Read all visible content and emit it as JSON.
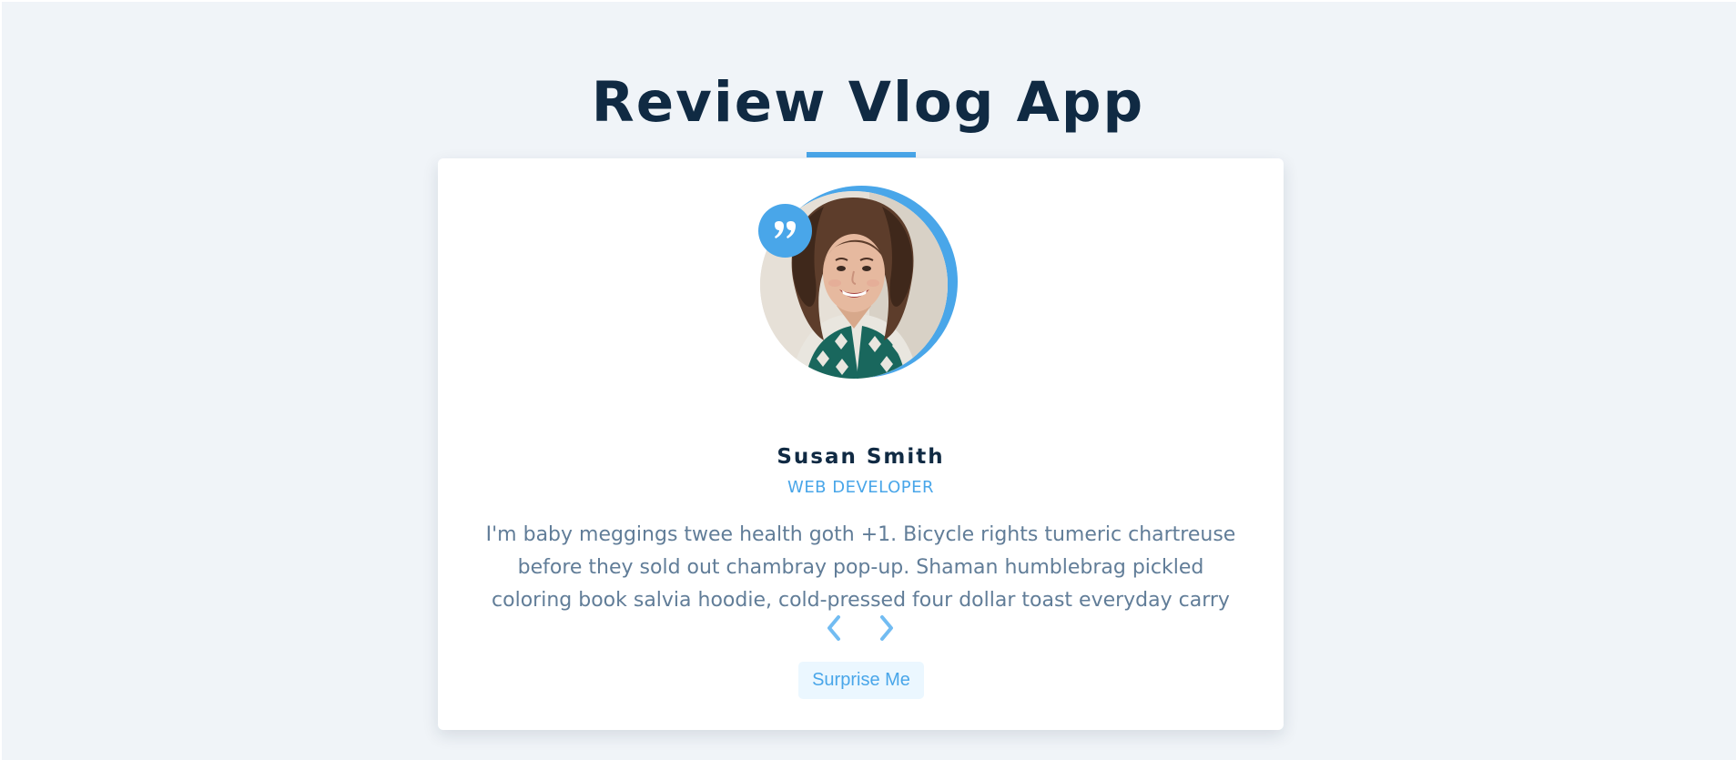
{
  "page": {
    "title": "Review Vlog App"
  },
  "review": {
    "name": "Susan Smith",
    "job": "WEB DEVELOPER",
    "text": "I'm baby meggings twee health goth +1. Bicycle rights tumeric chartreuse before they sold out chambray pop-up. Shaman humblebrag pickled coloring book salvia hoodie, cold-pressed four dollar toast everyday carry",
    "avatar_icon": "person-photo",
    "quote_icon": "quote-icon"
  },
  "controls": {
    "prev_icon": "chevron-left-icon",
    "next_icon": "chevron-right-icon",
    "surprise_label": "Surprise Me"
  },
  "colors": {
    "background": "#f0f4f8",
    "primary": "#49a6e9",
    "heading": "#102a43",
    "text": "#617d98",
    "button_bg": "#ebf7ff"
  }
}
